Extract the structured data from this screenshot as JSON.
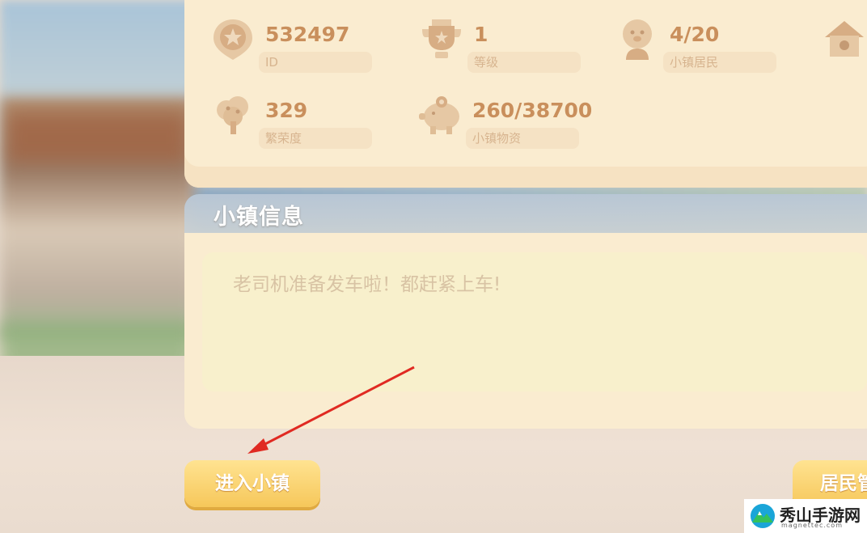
{
  "stats": [
    {
      "value": "532497",
      "label": "ID",
      "icon": "star-badge-icon"
    },
    {
      "value": "1",
      "label": "等级",
      "icon": "trophy-icon"
    },
    {
      "value": "4/20",
      "label": "小镇居民",
      "icon": "resident-icon"
    },
    {
      "value": "",
      "label": "",
      "icon": "house-icon"
    },
    {
      "value": "329",
      "label": "繁荣度",
      "icon": "tree-icon"
    },
    {
      "value": "260/38700",
      "label": "小镇物资",
      "icon": "piggy-bank-icon"
    }
  ],
  "info": {
    "title": "小镇信息",
    "message": "老司机准备发车啦！都赶紧上车!"
  },
  "buttons": {
    "enter_town": "进入小镇",
    "resident_manage": "居民管"
  },
  "watermark": {
    "name": "秀山手游网",
    "domain": "magnettec.com"
  },
  "colors": {
    "panel": "#faecd0",
    "value_text": "#c98f5c",
    "button": "#f6c75a",
    "arrow": "#e02a22"
  }
}
